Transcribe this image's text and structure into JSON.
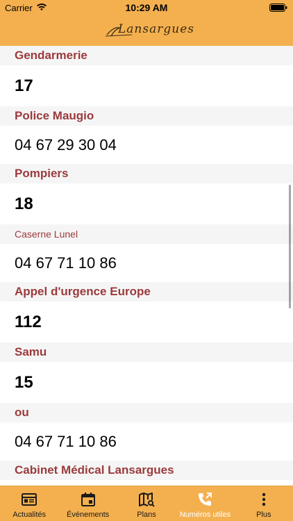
{
  "status_bar": {
    "carrier": "Carrier",
    "time": "10:29 AM"
  },
  "header": {
    "logo_text": "Lansargues"
  },
  "colors": {
    "accent": "#f4b04f",
    "section_title": "#9b3a3c",
    "active_tab": "#ffffff"
  },
  "entries": [
    {
      "title": "Gendarmerie",
      "number": "17"
    },
    {
      "title": "Police Maugio",
      "number": "04 67 29 30 04"
    },
    {
      "title": "Pompiers",
      "number": "18"
    },
    {
      "title": "Caserne Lunel",
      "number": "04 67 71 10 86"
    },
    {
      "title": "Appel d'urgence Europe",
      "number": "112"
    },
    {
      "title": "Samu",
      "number": "15"
    },
    {
      "title": "ou",
      "number": "04 67 71 10 86"
    },
    {
      "title": "Cabinet Médical Lansargues",
      "number": ""
    }
  ],
  "tabbar": {
    "items": [
      {
        "label": "Actualités",
        "icon": "newspaper-icon"
      },
      {
        "label": "Événements",
        "icon": "calendar-icon"
      },
      {
        "label": "Plans",
        "icon": "map-icon"
      },
      {
        "label": "Numéros utiles",
        "icon": "phone-icon",
        "active": true
      },
      {
        "label": "Plus",
        "icon": "more-icon"
      }
    ]
  }
}
